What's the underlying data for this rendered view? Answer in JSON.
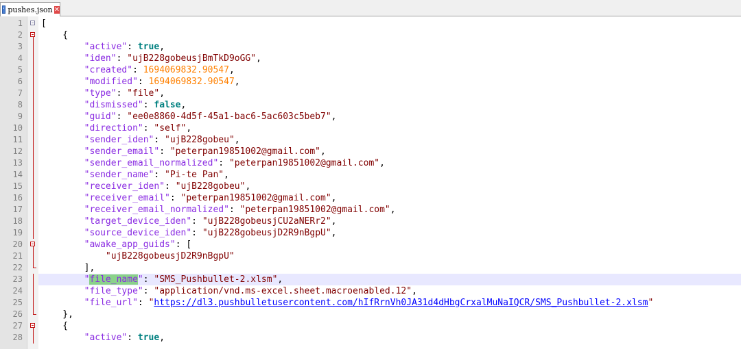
{
  "tab": {
    "label": "pushes.json",
    "close_glyph": "✕"
  },
  "lines": [
    {
      "n": "1",
      "fold": "first",
      "parts": [
        {
          "t": "p",
          "v": "["
        }
      ]
    },
    {
      "n": "2",
      "fold": "open",
      "parts": [
        {
          "t": "p",
          "v": "    {"
        }
      ]
    },
    {
      "n": "3",
      "fold": "bar",
      "parts": [
        {
          "t": "p",
          "v": "        "
        },
        {
          "t": "key",
          "v": "\"active\""
        },
        {
          "t": "p",
          "v": ": "
        },
        {
          "t": "bool",
          "v": "true"
        },
        {
          "t": "p",
          "v": ","
        }
      ]
    },
    {
      "n": "4",
      "fold": "bar",
      "parts": [
        {
          "t": "p",
          "v": "        "
        },
        {
          "t": "key",
          "v": "\"iden\""
        },
        {
          "t": "p",
          "v": ": "
        },
        {
          "t": "str",
          "v": "\"ujB228gobeusjBmTkD9oGG\""
        },
        {
          "t": "p",
          "v": ","
        }
      ]
    },
    {
      "n": "5",
      "fold": "bar",
      "parts": [
        {
          "t": "p",
          "v": "        "
        },
        {
          "t": "key",
          "v": "\"created\""
        },
        {
          "t": "p",
          "v": ": "
        },
        {
          "t": "num",
          "v": "1694069832.90547"
        },
        {
          "t": "p",
          "v": ","
        }
      ]
    },
    {
      "n": "6",
      "fold": "bar",
      "parts": [
        {
          "t": "p",
          "v": "        "
        },
        {
          "t": "key",
          "v": "\"modified\""
        },
        {
          "t": "p",
          "v": ": "
        },
        {
          "t": "num",
          "v": "1694069832.90547"
        },
        {
          "t": "p",
          "v": ","
        }
      ]
    },
    {
      "n": "7",
      "fold": "bar",
      "parts": [
        {
          "t": "p",
          "v": "        "
        },
        {
          "t": "key",
          "v": "\"type\""
        },
        {
          "t": "p",
          "v": ": "
        },
        {
          "t": "str",
          "v": "\"file\""
        },
        {
          "t": "p",
          "v": ","
        }
      ]
    },
    {
      "n": "8",
      "fold": "bar",
      "parts": [
        {
          "t": "p",
          "v": "        "
        },
        {
          "t": "key",
          "v": "\"dismissed\""
        },
        {
          "t": "p",
          "v": ": "
        },
        {
          "t": "bool",
          "v": "false"
        },
        {
          "t": "p",
          "v": ","
        }
      ]
    },
    {
      "n": "9",
      "fold": "bar",
      "parts": [
        {
          "t": "p",
          "v": "        "
        },
        {
          "t": "key",
          "v": "\"guid\""
        },
        {
          "t": "p",
          "v": ": "
        },
        {
          "t": "str",
          "v": "\"ee0e8860-4d5f-45a1-bac6-5ac603c5beb7\""
        },
        {
          "t": "p",
          "v": ","
        }
      ]
    },
    {
      "n": "10",
      "fold": "bar",
      "parts": [
        {
          "t": "p",
          "v": "        "
        },
        {
          "t": "key",
          "v": "\"direction\""
        },
        {
          "t": "p",
          "v": ": "
        },
        {
          "t": "str",
          "v": "\"self\""
        },
        {
          "t": "p",
          "v": ","
        }
      ]
    },
    {
      "n": "11",
      "fold": "bar",
      "parts": [
        {
          "t": "p",
          "v": "        "
        },
        {
          "t": "key",
          "v": "\"sender_iden\""
        },
        {
          "t": "p",
          "v": ": "
        },
        {
          "t": "str",
          "v": "\"ujB228gobeu\""
        },
        {
          "t": "p",
          "v": ","
        }
      ]
    },
    {
      "n": "12",
      "fold": "bar",
      "parts": [
        {
          "t": "p",
          "v": "        "
        },
        {
          "t": "key",
          "v": "\"sender_email\""
        },
        {
          "t": "p",
          "v": ": "
        },
        {
          "t": "str",
          "v": "\"peterpan19851002@gmail.com\""
        },
        {
          "t": "p",
          "v": ","
        }
      ]
    },
    {
      "n": "13",
      "fold": "bar",
      "parts": [
        {
          "t": "p",
          "v": "        "
        },
        {
          "t": "key",
          "v": "\"sender_email_normalized\""
        },
        {
          "t": "p",
          "v": ": "
        },
        {
          "t": "str",
          "v": "\"peterpan19851002@gmail.com\""
        },
        {
          "t": "p",
          "v": ","
        }
      ]
    },
    {
      "n": "14",
      "fold": "bar",
      "parts": [
        {
          "t": "p",
          "v": "        "
        },
        {
          "t": "key",
          "v": "\"sender_name\""
        },
        {
          "t": "p",
          "v": ": "
        },
        {
          "t": "str",
          "v": "\"Pi-te Pan\""
        },
        {
          "t": "p",
          "v": ","
        }
      ]
    },
    {
      "n": "15",
      "fold": "bar",
      "parts": [
        {
          "t": "p",
          "v": "        "
        },
        {
          "t": "key",
          "v": "\"receiver_iden\""
        },
        {
          "t": "p",
          "v": ": "
        },
        {
          "t": "str",
          "v": "\"ujB228gobeu\""
        },
        {
          "t": "p",
          "v": ","
        }
      ]
    },
    {
      "n": "16",
      "fold": "bar",
      "parts": [
        {
          "t": "p",
          "v": "        "
        },
        {
          "t": "key",
          "v": "\"receiver_email\""
        },
        {
          "t": "p",
          "v": ": "
        },
        {
          "t": "str",
          "v": "\"peterpan19851002@gmail.com\""
        },
        {
          "t": "p",
          "v": ","
        }
      ]
    },
    {
      "n": "17",
      "fold": "bar",
      "parts": [
        {
          "t": "p",
          "v": "        "
        },
        {
          "t": "key",
          "v": "\"receiver_email_normalized\""
        },
        {
          "t": "p",
          "v": ": "
        },
        {
          "t": "str",
          "v": "\"peterpan19851002@gmail.com\""
        },
        {
          "t": "p",
          "v": ","
        }
      ]
    },
    {
      "n": "18",
      "fold": "bar",
      "parts": [
        {
          "t": "p",
          "v": "        "
        },
        {
          "t": "key",
          "v": "\"target_device_iden\""
        },
        {
          "t": "p",
          "v": ": "
        },
        {
          "t": "str",
          "v": "\"ujB228gobeusjCU2aNERr2\""
        },
        {
          "t": "p",
          "v": ","
        }
      ]
    },
    {
      "n": "19",
      "fold": "bar",
      "parts": [
        {
          "t": "p",
          "v": "        "
        },
        {
          "t": "key",
          "v": "\"source_device_iden\""
        },
        {
          "t": "p",
          "v": ": "
        },
        {
          "t": "str",
          "v": "\"ujB228gobeusjD2R9nBgpU\""
        },
        {
          "t": "p",
          "v": ","
        }
      ]
    },
    {
      "n": "20",
      "fold": "open",
      "parts": [
        {
          "t": "p",
          "v": "        "
        },
        {
          "t": "key",
          "v": "\"awake_app_guids\""
        },
        {
          "t": "p",
          "v": ": ["
        }
      ]
    },
    {
      "n": "21",
      "fold": "bar",
      "parts": [
        {
          "t": "p",
          "v": "            "
        },
        {
          "t": "str",
          "v": "\"ujB228gobeusjD2R9nBgpU\""
        }
      ]
    },
    {
      "n": "22",
      "fold": "end",
      "parts": [
        {
          "t": "p",
          "v": "        ],"
        }
      ]
    },
    {
      "n": "23",
      "fold": "bar",
      "current": true,
      "parts": [
        {
          "t": "p",
          "v": "        "
        },
        {
          "t": "key",
          "v": "\""
        },
        {
          "t": "keyhl",
          "v": "file_name"
        },
        {
          "t": "key",
          "v": "\""
        },
        {
          "t": "p",
          "v": ": "
        },
        {
          "t": "str",
          "v": "\"SMS_Pushbullet-2.xlsm\""
        },
        {
          "t": "p",
          "v": ","
        }
      ]
    },
    {
      "n": "24",
      "fold": "bar",
      "parts": [
        {
          "t": "p",
          "v": "        "
        },
        {
          "t": "key",
          "v": "\"file_type\""
        },
        {
          "t": "p",
          "v": ": "
        },
        {
          "t": "str",
          "v": "\"application/vnd.ms-excel.sheet.macroenabled.12\""
        },
        {
          "t": "p",
          "v": ","
        }
      ]
    },
    {
      "n": "25",
      "fold": "bar",
      "parts": [
        {
          "t": "p",
          "v": "        "
        },
        {
          "t": "key",
          "v": "\"file_url\""
        },
        {
          "t": "p",
          "v": ": "
        },
        {
          "t": "str",
          "v": "\""
        },
        {
          "t": "url",
          "v": "https://dl3.pushbulletusercontent.com/hIfRrnVh0JA31d4dHbgCrxalMuNaIQCR/SMS_Pushbullet-2.xlsm"
        },
        {
          "t": "str",
          "v": "\""
        }
      ]
    },
    {
      "n": "26",
      "fold": "end",
      "parts": [
        {
          "t": "p",
          "v": "    },"
        }
      ]
    },
    {
      "n": "27",
      "fold": "open",
      "parts": [
        {
          "t": "p",
          "v": "    {"
        }
      ]
    },
    {
      "n": "28",
      "fold": "bar",
      "parts": [
        {
          "t": "p",
          "v": "        "
        },
        {
          "t": "key",
          "v": "\"active\""
        },
        {
          "t": "p",
          "v": ": "
        },
        {
          "t": "bool",
          "v": "true"
        },
        {
          "t": "p",
          "v": ","
        }
      ]
    }
  ]
}
